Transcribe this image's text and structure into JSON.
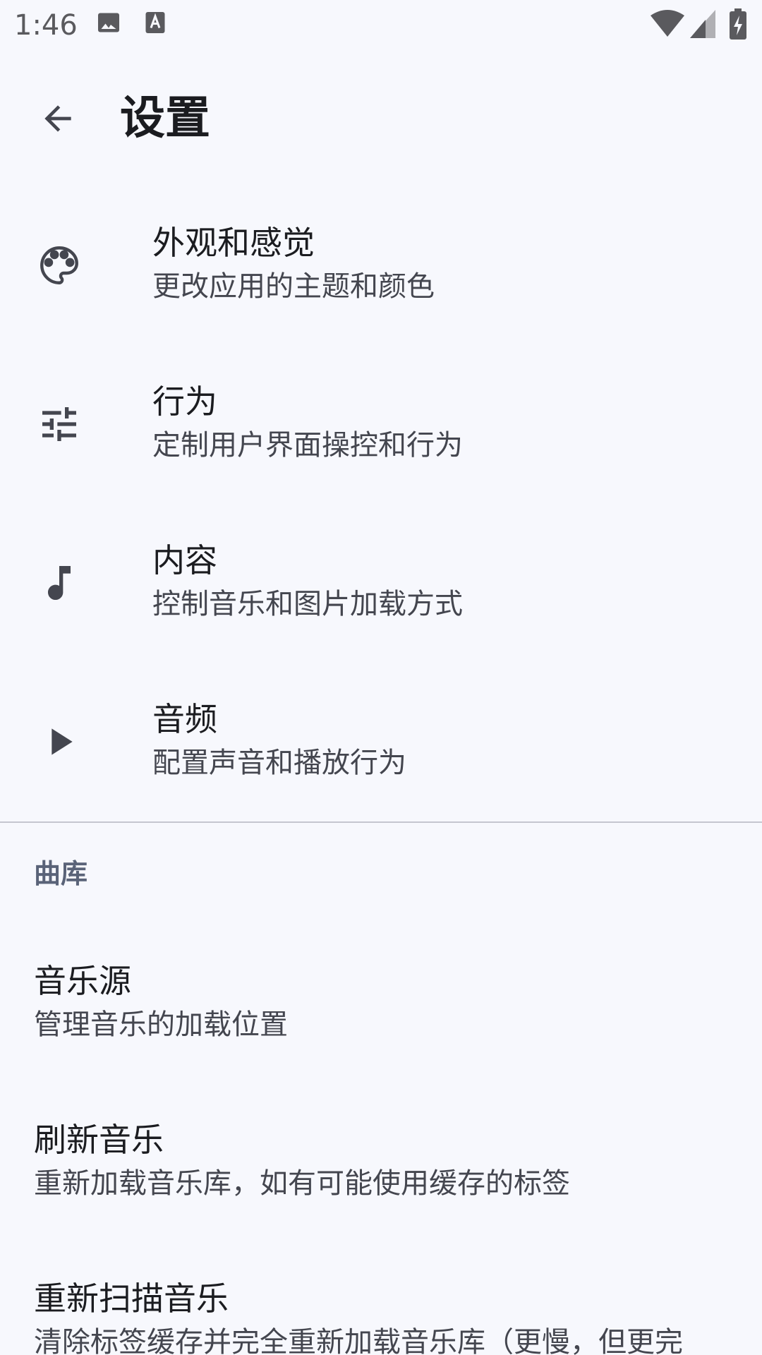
{
  "status_bar": {
    "time": "1:46",
    "icons": [
      "image-icon",
      "a-badge-icon",
      "wifi-icon",
      "signal-icon",
      "battery-charging-icon"
    ]
  },
  "app_bar": {
    "back_icon": "arrow-back-icon",
    "title": "设置"
  },
  "settings": [
    {
      "icon": "palette-icon",
      "title": "外观和感觉",
      "summary": "更改应用的主题和颜色"
    },
    {
      "icon": "tune-icon",
      "title": "行为",
      "summary": "定制用户界面操控和行为"
    },
    {
      "icon": "music-note-icon",
      "title": "内容",
      "summary": "控制音乐和图片加载方式"
    },
    {
      "icon": "play-icon",
      "title": "音频",
      "summary": "配置声音和播放行为"
    }
  ],
  "library": {
    "header": "曲库",
    "items": [
      {
        "title": "音乐源",
        "summary": "管理音乐的加载位置"
      },
      {
        "title": "刷新音乐",
        "summary": "重新加载音乐库，如有可能使用缓存的标签"
      },
      {
        "title": "重新扫描音乐",
        "summary": "清除标签缓存并完全重新加载音乐库（更慢，但更完"
      }
    ]
  },
  "colors": {
    "background": "#f7f8fd",
    "icon": "#44464f",
    "section_header": "#5a6378",
    "divider": "#c5c6d0"
  }
}
